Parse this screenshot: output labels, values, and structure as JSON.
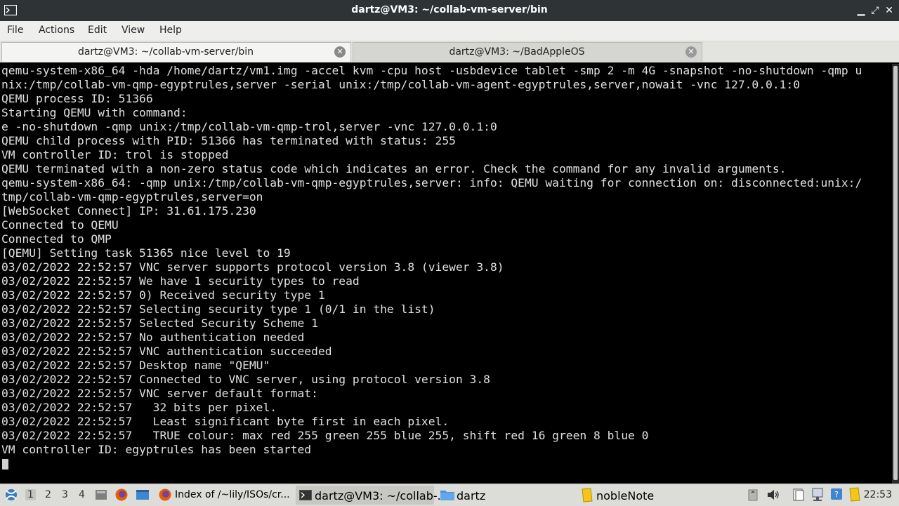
{
  "window": {
    "title": "dartz@VM3: ~/collab-vm-server/bin",
    "minimize_glyph": "▁",
    "maximize_glyph": "⤢",
    "close_glyph": "✕"
  },
  "menu": [
    "File",
    "Actions",
    "Edit",
    "View",
    "Help"
  ],
  "tabs": [
    {
      "label": "dartz@VM3: ~/collab-vm-server/bin",
      "active": true
    },
    {
      "label": "dartz@VM3: ~/BadAppleOS",
      "active": false
    }
  ],
  "terminal": {
    "lines": [
      "qemu-system-x86_64 -hda /home/dartz/vm1.img -accel kvm -cpu host -usbdevice tablet -smp 2 -m 4G -snapshot -no-shutdown -qmp u",
      "nix:/tmp/collab-vm-qmp-egyptrules,server -serial unix:/tmp/collab-vm-agent-egyptrules,server,nowait -vnc 127.0.0.1:0",
      "QEMU process ID: 51366",
      "Starting QEMU with command:",
      "e -no-shutdown -qmp unix:/tmp/collab-vm-qmp-trol,server -vnc 127.0.0.1:0",
      "QEMU child process with PID: 51366 has terminated with status: 255",
      "VM controller ID: trol is stopped",
      "QEMU terminated with a non-zero status code which indicates an error. Check the command for any invalid arguments.",
      "qemu-system-x86_64: -qmp unix:/tmp/collab-vm-qmp-egyptrules,server: info: QEMU waiting for connection on: disconnected:unix:/",
      "tmp/collab-vm-qmp-egyptrules,server=on",
      "[WebSocket Connect] IP: 31.61.175.230",
      "Connected to QEMU",
      "Connected to QMP",
      "[QEMU] Setting task 51365 nice level to 19",
      "03/02/2022 22:52:57 VNC server supports protocol version 3.8 (viewer 3.8)",
      "03/02/2022 22:52:57 We have 1 security types to read",
      "03/02/2022 22:52:57 0) Received security type 1",
      "03/02/2022 22:52:57 Selecting security type 1 (0/1 in the list)",
      "03/02/2022 22:52:57 Selected Security Scheme 1",
      "03/02/2022 22:52:57 No authentication needed",
      "03/02/2022 22:52:57 VNC authentication succeeded",
      "03/02/2022 22:52:57 Desktop name \"QEMU\"",
      "03/02/2022 22:52:57 Connected to VNC server, using protocol version 3.8",
      "03/02/2022 22:52:57 VNC server default format:",
      "03/02/2022 22:52:57   32 bits per pixel.",
      "03/02/2022 22:52:57   Least significant byte first in each pixel.",
      "03/02/2022 22:52:57   TRUE colour: max red 255 green 255 blue 255, shift red 16 green 8 blue 0",
      "VM controller ID: egyptrules has been started"
    ]
  },
  "taskbar": {
    "workspaces": [
      "1",
      "2",
      "3",
      "4"
    ],
    "active_workspace": "1",
    "tasks": [
      {
        "label": "Index of /~lily/ISOs/cr...",
        "icon": "firefox-icon"
      },
      {
        "label": "dartz@VM3: ~/collab-...",
        "icon": "terminal-icon",
        "active": true
      },
      {
        "label": "dartz",
        "icon": "folder-icon"
      },
      {
        "label": "nobleNote",
        "icon": "note-icon"
      }
    ],
    "clock": "22:53"
  },
  "colors": {
    "titlebar": "#2e3436",
    "terminal_bg": "#000000",
    "terminal_fg": "#e0e0e0",
    "taskbar": "#dcdcd8"
  }
}
